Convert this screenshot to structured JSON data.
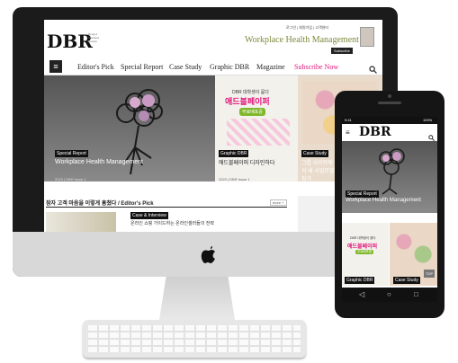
{
  "desktop": {
    "logo": "DBR",
    "logo_sub": "Dong-A Business Review",
    "top_links": "로그인 | 회원가입 | 고객센터",
    "banner_title": "Workplace Health Management",
    "banner_button": "Subscribe",
    "nav": [
      "Editor's Pick",
      "Special Report",
      "Case Study",
      "Graphic DBR",
      "Magazine",
      "Subscribe Now"
    ],
    "hero_left": {
      "category": "Special Report",
      "title": "Workplace Health Management",
      "meta": "2023 | DBR Issue 1"
    },
    "hero_mid": {
      "top": "DBR 대학생이 묻다",
      "headline": "애드블페이퍼",
      "badge": "무료배포중",
      "category": "Graphic DBR",
      "title": "애드블페이퍼 디자인하다",
      "meta": "2023 | DBR Issue 1"
    },
    "hero_right": {
      "category": "Case Study",
      "title": "그룹 사이트에서 새 사업모델 찾기"
    },
    "section_title": "잠자 고객 마음을 이렇게 훔쳤다 / Editor's Pick",
    "section_more": "more +",
    "feature_category": "Case & Interview",
    "feature_title": "온라인 쇼핑 가이드하는 온라인셀러들의 전략"
  },
  "phone": {
    "status_left": "9:41",
    "status_right": "100%",
    "logo": "DBR",
    "hero_category": "Special Report",
    "hero_title": "Workplace Health Management",
    "mid_top": "DBR 대학생이 묻다",
    "mid_headline": "애드블페이퍼",
    "mid_badge": "무료배포중",
    "cat_left": "Graphic DBR",
    "cat_right": "Case Study",
    "top_label": "TOP"
  },
  "colors": {
    "accent": "#e0147a",
    "green": "#7fb72b",
    "dark": "#111111"
  }
}
